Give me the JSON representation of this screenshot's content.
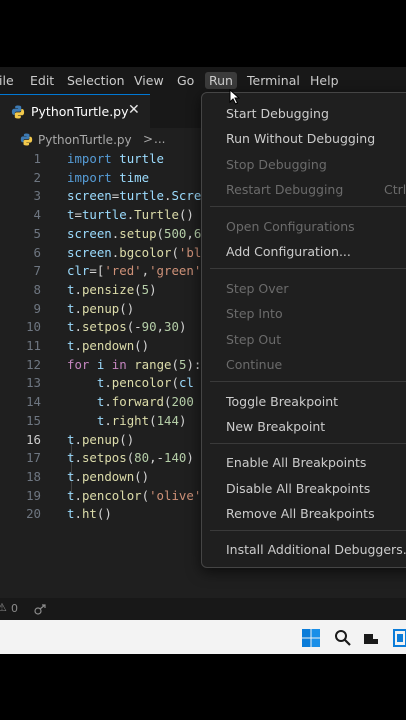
{
  "menubar": {
    "items": [
      "ile",
      "Edit",
      "Selection",
      "View",
      "Go",
      "Run",
      "Terminal",
      "Help"
    ],
    "active": "Run"
  },
  "tab": {
    "label": "PythonTurtle.py",
    "close_icon": "close-icon"
  },
  "breadcrumb": {
    "file": "PythonTurtle.py",
    "separator": ">",
    "more": "..."
  },
  "editor": {
    "current_line": 16,
    "lines": [
      {
        "n": "1",
        "t": "import turtle"
      },
      {
        "n": "2",
        "t": "import time"
      },
      {
        "n": "3",
        "t": "screen=turtle.Scre"
      },
      {
        "n": "4",
        "t": "t=turtle.Turtle()"
      },
      {
        "n": "5",
        "t": "screen.setup(500,6"
      },
      {
        "n": "6",
        "t": "screen.bgcolor('bl"
      },
      {
        "n": "7",
        "t": "clr=['red','green'"
      },
      {
        "n": "8",
        "t": "t.pensize(5)"
      },
      {
        "n": "9",
        "t": "t.penup()"
      },
      {
        "n": "10",
        "t": "t.setpos(-90,30)"
      },
      {
        "n": "11",
        "t": "t.pendown()"
      },
      {
        "n": "12",
        "t": "for i in range(5):"
      },
      {
        "n": "13",
        "t": "    t.pencolor(cl"
      },
      {
        "n": "14",
        "t": "    t.forward(200"
      },
      {
        "n": "15",
        "t": "    t.right(144)"
      },
      {
        "n": "16",
        "t": "t.penup()"
      },
      {
        "n": "17",
        "t": "t.setpos(80,-140)"
      },
      {
        "n": "18",
        "t": "t.pendown()"
      },
      {
        "n": "19",
        "t": "t.pencolor('olive'"
      },
      {
        "n": "20",
        "t": "t.ht()"
      }
    ]
  },
  "run_menu": {
    "start_debugging": "Start Debugging",
    "run_without_debugging": "Run Without Debugging",
    "stop_debugging": "Stop Debugging",
    "restart_debugging": "Restart Debugging",
    "restart_shortcut": "Ctrl+",
    "open_configurations": "Open Configurations",
    "add_configuration": "Add Configuration...",
    "step_over": "Step Over",
    "step_into": "Step Into",
    "step_out": "Step Out",
    "continue": "Continue",
    "toggle_breakpoint": "Toggle Breakpoint",
    "new_breakpoint": "New Breakpoint",
    "enable_all_breakpoints": "Enable All Breakpoints",
    "disable_all_breakpoints": "Disable All Breakpoints",
    "remove_all_breakpoints": "Remove All Breakpoints",
    "install_additional_debuggers": "Install Additional Debuggers..."
  },
  "statusbar": {
    "problems": "0"
  },
  "colors": {
    "keyword_blue": "#569cd6",
    "keyword_purple": "#c586c0",
    "function": "#dcdcaa",
    "string": "#ce9178",
    "number": "#b5cea8",
    "variable": "#9cdcfe",
    "accent": "#0078d4"
  }
}
